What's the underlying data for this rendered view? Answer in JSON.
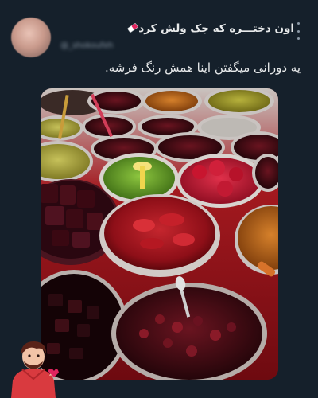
{
  "tweet": {
    "display_name": "اون دختـــره که جک ولش کرد",
    "handle": "@_shokoufeh",
    "text": "یه دورانی میگفتن اینا همش رنگ فرشه.",
    "more_icon": "more-vertical-icon",
    "badge_icon": "eraser-emoji-icon"
  },
  "media": {
    "description_icon": "jam-bowls-photo"
  },
  "sticker": {
    "icon": "cartoon-man-sticker"
  },
  "colors": {
    "background": "#15202b",
    "text_primary": "#e7e9ea",
    "text_secondary": "#8b98a5"
  }
}
